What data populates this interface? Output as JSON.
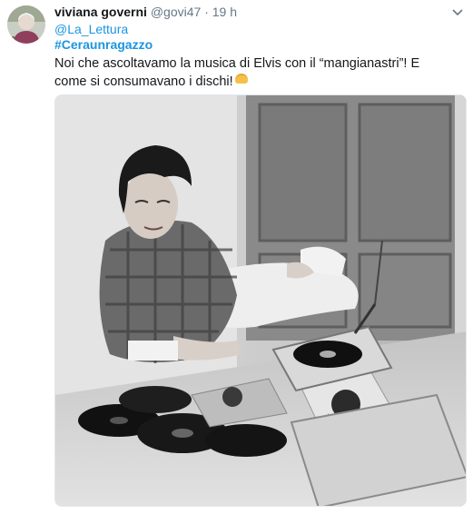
{
  "tweet": {
    "display_name": "viviana governi",
    "handle": "@govi47",
    "separator": "·",
    "time": "19 h",
    "reply_to": "@La_Lettura",
    "hashtag": "#Ceraunragazzo",
    "text": "Noi che ascoltavamo la musica di Elvis con il “mangianastri”! E come si consumavano i dischi!",
    "emoji": "grinning-face-emoji",
    "more_icon": "chevron-down-icon",
    "avatar_icon": "profile-photo",
    "media": "black-and-white photo of a young person lying on the floor beside a portable record player, surrounded by vinyl records and record sleeves"
  },
  "colors": {
    "link": "#1b95e0",
    "text": "#14171a",
    "muted": "#657786"
  }
}
